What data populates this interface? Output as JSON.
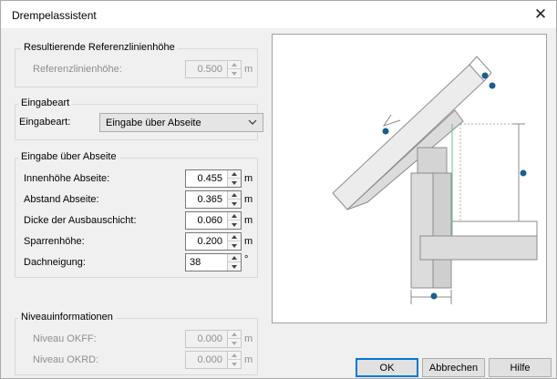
{
  "window": {
    "title": "Drempelassistent"
  },
  "group_reference": {
    "title": "Resultierende Referenzlinienhöhe",
    "field": {
      "label": "Referenzlinienhöhe:",
      "value": "0.500",
      "unit": "m"
    }
  },
  "group_input_type": {
    "title": "Eingabeart",
    "label": "Eingabeart:",
    "selected": "Eingabe über Abseite"
  },
  "group_abseite": {
    "title": "Eingabe über Abseite",
    "fields": [
      {
        "label": "Innenhöhe Abseite:",
        "value": "0.455",
        "unit": "m"
      },
      {
        "label": "Abstand Abseite:",
        "value": "0.365",
        "unit": "m"
      },
      {
        "label": "Dicke der Ausbauschicht:",
        "value": "0.060",
        "unit": "m"
      },
      {
        "label": "Sparrenhöhe:",
        "value": "0.200",
        "unit": "m"
      },
      {
        "label": "Dachneigung:",
        "value": "38",
        "unit": "°"
      }
    ]
  },
  "group_levels": {
    "title": "Niveauinformationen",
    "fields": [
      {
        "label": "Niveau OKFF:",
        "value": "0.000",
        "unit": "m"
      },
      {
        "label": "Niveau OKRD:",
        "value": "0.000",
        "unit": "m"
      }
    ]
  },
  "buttons": {
    "ok": "OK",
    "cancel": "Abbrechen",
    "help": "Hilfe"
  },
  "icons": {
    "close": "close-icon",
    "dropdown": "chevron-down-icon",
    "spin_up": "spin-up-icon",
    "spin_down": "spin-down-icon"
  },
  "colors": {
    "accent": "#0078d7",
    "marker": "#1b5e8a",
    "preview_gray": "#d0d0d0"
  }
}
